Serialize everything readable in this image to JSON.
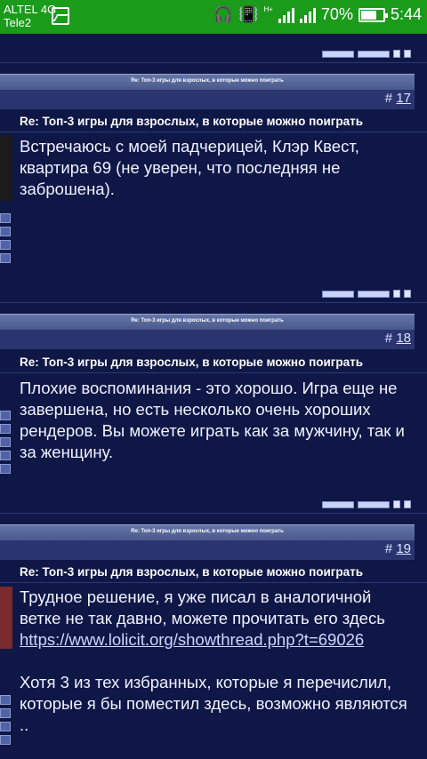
{
  "status_bar": {
    "carrier1": "ALTEL 4G",
    "carrier2": "Tele2",
    "network_type": "H+",
    "battery": "70%",
    "time": "5:44"
  },
  "thread_title": "Re: Топ-3 игры для взрослых, в которые можно поиграть",
  "posts": [
    {
      "number": "17",
      "subject": "Re: Топ-3 игры для взрослых, в которые можно поиграть",
      "body": "Встречаюсь с моей падчерицей, Клэр Квест, квартира 69 (не уверен, что последняя не заброшена)."
    },
    {
      "number": "18",
      "subject": "Re: Топ-3 игры для взрослых, в которые можно поиграть",
      "body": "Плохие воспоминания - это хорошо. Игра еще не завершена, но есть несколько очень хороших рендеров. Вы можете играть как за мужчину, так и за женщину."
    },
    {
      "number": "19",
      "subject": "Re: Топ-3 игры для взрослых, в которые можно поиграть",
      "body_part1": "Трудное решение, я уже писал в аналогичной ветке не так давно, можете прочитать его здесь",
      "link": "https://www.lolicit.org/showthread.php?t=69026",
      "body_part2": "Хотя 3 из тех избранных, которые я перечислил, которые я бы поместил здесь, возможно являются .."
    }
  ],
  "hash": "#",
  "icons": [
    "image-icon",
    "headphones-icon",
    "vibrate-icon",
    "signal-icon",
    "battery-icon"
  ],
  "colors": {
    "status_bar": "#1a9b1a",
    "page_bg": "#0f1747",
    "header_bar": "#4a5a8f"
  }
}
